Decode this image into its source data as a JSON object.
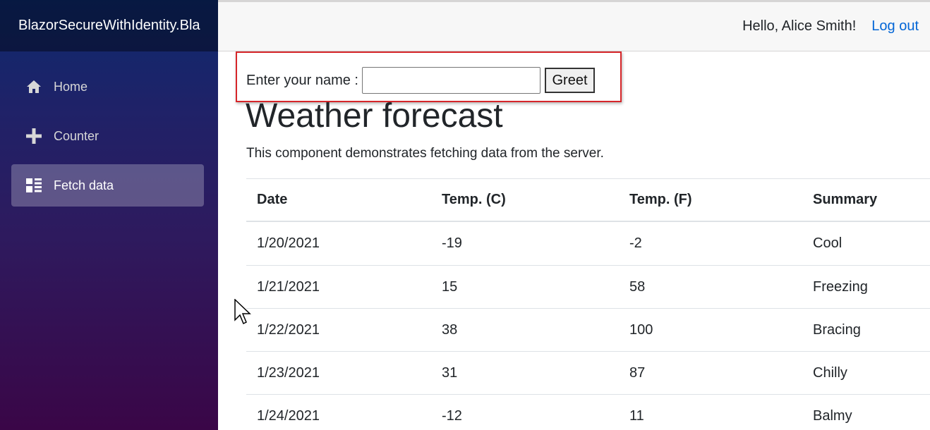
{
  "brand": "BlazorSecureWithIdentity.Bla",
  "nav": {
    "items": [
      {
        "label": "Home",
        "icon": "home-icon"
      },
      {
        "label": "Counter",
        "icon": "plus-icon"
      },
      {
        "label": "Fetch data",
        "icon": "list-icon"
      }
    ],
    "active_index": 2
  },
  "topbar": {
    "greeting": "Hello, Alice Smith!",
    "logout": "Log out"
  },
  "greet": {
    "label": "Enter your name :",
    "input_value": "",
    "button": "Greet"
  },
  "page": {
    "title": "Weather forecast",
    "subtitle": "This component demonstrates fetching data from the server."
  },
  "table": {
    "headers": [
      "Date",
      "Temp. (C)",
      "Temp. (F)",
      "Summary"
    ],
    "rows": [
      [
        "1/20/2021",
        "-19",
        "-2",
        "Cool"
      ],
      [
        "1/21/2021",
        "15",
        "58",
        "Freezing"
      ],
      [
        "1/22/2021",
        "38",
        "100",
        "Bracing"
      ],
      [
        "1/23/2021",
        "31",
        "87",
        "Chilly"
      ],
      [
        "1/24/2021",
        "-12",
        "11",
        "Balmy"
      ]
    ]
  },
  "colors": {
    "accent_link": "#0366d6",
    "highlight_border": "#d6262a"
  }
}
